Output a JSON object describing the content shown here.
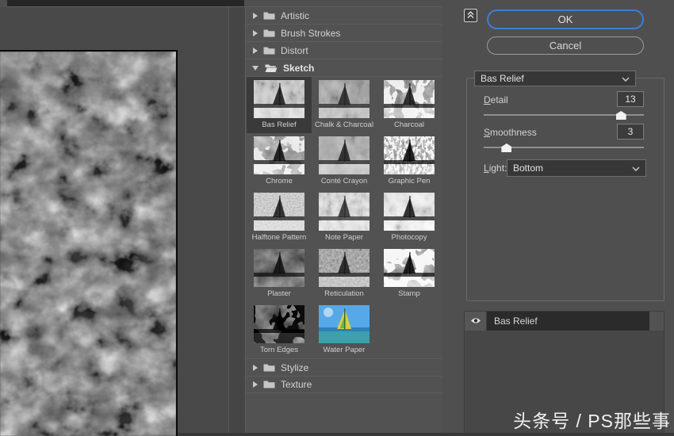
{
  "filter_list": {
    "categories": [
      {
        "label": "Artistic",
        "expanded": false
      },
      {
        "label": "Brush Strokes",
        "expanded": false
      },
      {
        "label": "Distort",
        "expanded": false
      },
      {
        "label": "Sketch",
        "expanded": true
      },
      {
        "label": "Stylize",
        "expanded": false
      },
      {
        "label": "Texture",
        "expanded": false
      }
    ],
    "sketch_filters": [
      {
        "label": "Bas Relief",
        "slug": "bas-relief",
        "selected": true
      },
      {
        "label": "Chalk & Charcoal",
        "slug": "chalk-charcoal",
        "selected": false
      },
      {
        "label": "Charcoal",
        "slug": "charcoal",
        "selected": false
      },
      {
        "label": "Chrome",
        "slug": "chrome",
        "selected": false
      },
      {
        "label": "Conté Crayon",
        "slug": "conte-crayon",
        "selected": false
      },
      {
        "label": "Graphic Pen",
        "slug": "graphic-pen",
        "selected": false
      },
      {
        "label": "Halftone Pattern",
        "slug": "halftone-pattern",
        "selected": false
      },
      {
        "label": "Note Paper",
        "slug": "note-paper",
        "selected": false
      },
      {
        "label": "Photocopy",
        "slug": "photocopy",
        "selected": false
      },
      {
        "label": "Plaster",
        "slug": "plaster",
        "selected": false
      },
      {
        "label": "Reticulation",
        "slug": "reticulation",
        "selected": false
      },
      {
        "label": "Stamp",
        "slug": "stamp",
        "selected": false
      },
      {
        "label": "Torn Edges",
        "slug": "torn-edges",
        "selected": false
      },
      {
        "label": "Water Paper",
        "slug": "water-paper",
        "selected": false
      }
    ]
  },
  "actions": {
    "ok_label": "OK",
    "cancel_label": "Cancel"
  },
  "settings": {
    "selected_filter": "Bas Relief",
    "detail": {
      "label": "Detail",
      "value": 13,
      "min": 1,
      "max": 15
    },
    "smoothness": {
      "label": "Smoothness",
      "value": 3,
      "min": 1,
      "max": 15
    },
    "light": {
      "label": "Light:",
      "value": "Bottom"
    }
  },
  "effect_layers": [
    {
      "name": "Bas Relief",
      "visible": true
    }
  ],
  "watermark": "头条号 / PS那些事",
  "colors": {
    "accent_blue": "#3f7dd6",
    "panel_bg": "#505050",
    "selection_bg": "#3a3a3a",
    "layer_row_bg": "#2b2b2b"
  }
}
